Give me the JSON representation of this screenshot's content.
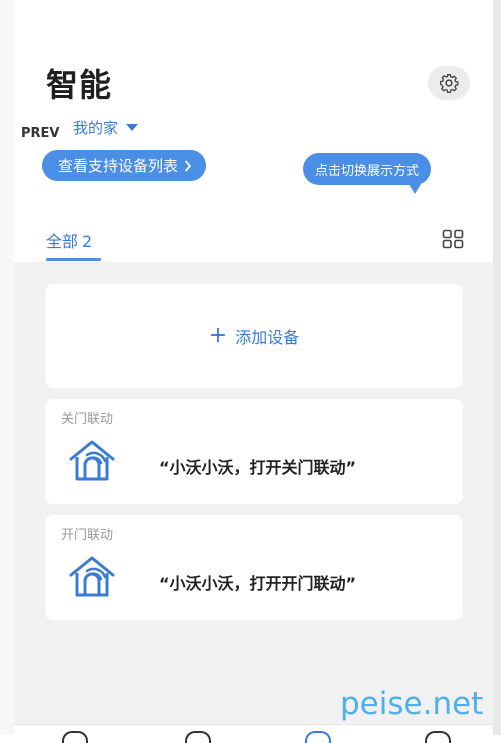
{
  "header": {
    "title": "智能",
    "prev_label": "PREV",
    "home_selector": "我的家",
    "device_list_button": "查看支持设备列表",
    "tooltip": "点击切换展示方式"
  },
  "tabs": [
    {
      "label": "全部",
      "count": "2"
    }
  ],
  "add_device": {
    "label": "添加设备"
  },
  "scenes": [
    {
      "name": "关门联动",
      "command": "“小沃小沃，打开关门联动”"
    },
    {
      "name": "开门联动",
      "command": "“小沃小沃，打开开门联动”"
    }
  ],
  "watermark": "peise.net",
  "colors": {
    "accent": "#3a7bd5",
    "button_bg": "#4b8ee6",
    "content_bg": "#f1f1f1"
  },
  "icons": [
    "gear-icon",
    "caret-down-icon",
    "chevron-right-icon",
    "grid-view-icon",
    "plus-icon",
    "smart-home-icon"
  ]
}
